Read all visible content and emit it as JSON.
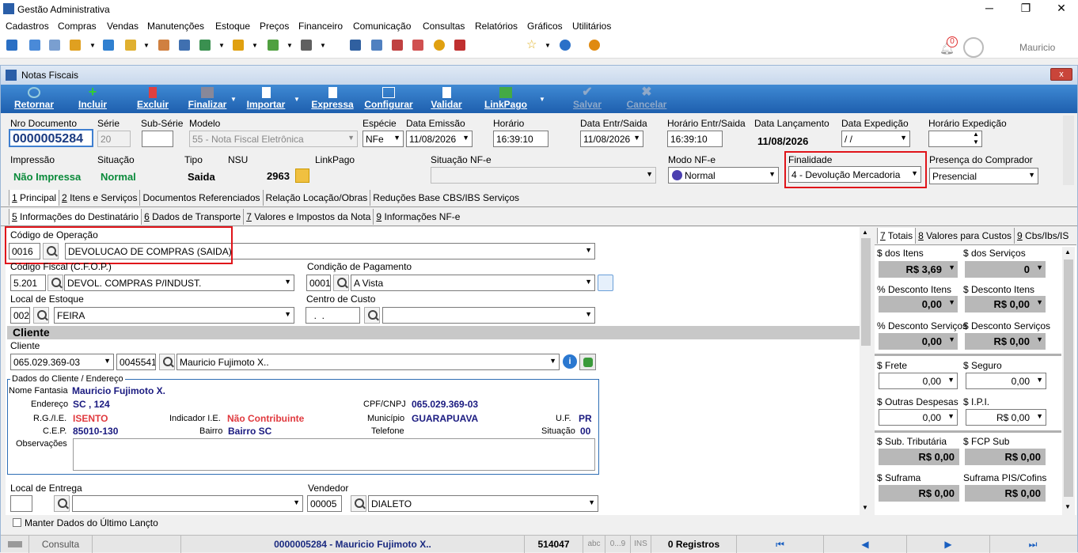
{
  "app": {
    "title": "Gestão Administrativa",
    "user": "Mauricio",
    "notif_count": "0"
  },
  "menu": [
    "Cadastros",
    "Compras",
    "Vendas",
    "Manutenções",
    "Estoque",
    "Preços",
    "Financeiro",
    "Comunicação",
    "Consultas",
    "Relatórios",
    "Gráficos",
    "Utilitários"
  ],
  "window": {
    "title": "Notas Fiscais",
    "close": "x"
  },
  "toolbar": {
    "retornar": "Retornar",
    "incluir": "Incluir",
    "excluir": "Excluir",
    "finalizar": "Finalizar",
    "importar": "Importar",
    "expressa": "Expressa",
    "configurar": "Configurar",
    "validar": "Validar",
    "linkpago": "LinkPago",
    "salvar": "Salvar",
    "cancelar": "Cancelar"
  },
  "header": {
    "nro_label": "Nro Documento",
    "nro": "0000005284",
    "serie_label": "Série",
    "serie": "20",
    "subserie_label": "Sub-Série",
    "subserie": "",
    "modelo_label": "Modelo",
    "modelo": "55 - Nota Fiscal Eletrônica",
    "especie_label": "Espécie",
    "especie": "NFe",
    "emissao_label": "Data Emissão",
    "emissao": "11/08/2026",
    "horario_label": "Horário",
    "horario": "16:39:10",
    "entr_label": "Data Entr/Saida",
    "entr": "11/08/2026",
    "hentr_label": "Horário Entr/Saida",
    "hentr": "16:39:10",
    "lanc_label": "Data Lançamento",
    "lanc": "11/08/2026",
    "exped_label": "Data Expedição",
    "exped": " / /",
    "hexped_label": "Horário Expedição",
    "hexped": "",
    "impressao_label": "Impressão",
    "impressao": "Não Impressa",
    "situacao_label": "Situação",
    "situacao": "Normal",
    "tipo_label": "Tipo",
    "tipo": "Saida",
    "nsu_label": "NSU",
    "nsu": "2963",
    "linkpago_label": "LinkPago",
    "sitnfe_label": "Situação NF-e",
    "sitnfe": "",
    "modonfe_label": "Modo NF-e",
    "modonfe": "Normal",
    "finalidade_label": "Finalidade",
    "finalidade": "4 - Devolução Mercadoria",
    "presenca_label": "Presença do Comprador",
    "presenca": "Presencial"
  },
  "tabs1": [
    {
      "k": "1",
      "t": " Principal"
    },
    {
      "k": "2",
      "t": " Itens e Serviços"
    },
    {
      "k": "",
      "t": "Documentos Referenciados"
    },
    {
      "k": "",
      "t": "Relação Locação/Obras"
    },
    {
      "k": "",
      "t": "Reduções Base CBS/IBS Serviços"
    }
  ],
  "tabs2": [
    {
      "k": "5",
      "t": " Informações do Destinatário"
    },
    {
      "k": "6",
      "t": " Dados de Transporte"
    },
    {
      "k": "7",
      "t": " Valores e Impostos da Nota"
    },
    {
      "k": "9",
      "t": " Informações NF-e"
    }
  ],
  "form": {
    "codop_label": "Código de Operação",
    "codop": "0016",
    "codop_desc": "DEVOLUCAO DE COMPRAS (SAIDA)",
    "cfop_label": "Código Fiscal (C.F.O.P.)",
    "cfop": "5.201",
    "cfop_desc": "DEVOL. COMPRAS P/INDUST.",
    "condpag_label": "Condição de Pagamento",
    "condpag": "0001",
    "condpag_desc": "A Vista",
    "local_label": "Local de Estoque",
    "local": "002",
    "local_desc": "FEIRA",
    "centro_label": "Centro de Custo",
    "centro": "  .  .",
    "centro_desc": "",
    "cliente_section": "Cliente",
    "cliente_label": "Cliente",
    "cpf": "065.029.369-03",
    "cod": "0045541",
    "nome": "Mauricio Fujimoto X..",
    "dados_label": "Dados do Cliente / Endereço",
    "fantasia_label": "Nome Fantasia",
    "fantasia": "Mauricio Fujimoto X.",
    "endereco_label": "Endereço",
    "endereco": "SC , 124",
    "cpfcnpj_label": "CPF/CNPJ",
    "cpfcnpj": "065.029.369-03",
    "rg_label": "R.G./I.E.",
    "rg": "ISENTO",
    "indie_label": "Indicador I.E.",
    "indie": "Não Contribuinte",
    "mun_label": "Município",
    "mun": "GUARAPUAVA",
    "uf_label": "U.F.",
    "uf": "PR",
    "cep_label": "C.E.P.",
    "cep": "85010-130",
    "bairro_label": "Bairro",
    "bairro": "Bairro SC",
    "tel_label": "Telefone",
    "tel": "",
    "sit_label": "Situação",
    "sit": "00",
    "obs_label": "Observações",
    "entrega_label": "Local de Entrega",
    "vendedor_label": "Vendedor",
    "vendedor": "00005",
    "vendedor_desc": "DIALETO",
    "manter": "Manter Dados do Último Lançto"
  },
  "totais": {
    "tabs": [
      {
        "k": "7",
        "t": " Totais"
      },
      {
        "k": "8",
        "t": " Valores para Custos"
      },
      {
        "k": "9",
        "t": " Cbs/Ibs/IS"
      }
    ],
    "itens_label": "$ dos Itens",
    "itens": "R$ 3,69",
    "servicos_label": "$ dos Serviços",
    "servicos": "0",
    "pdesc_itens_label": "% Desconto Itens",
    "pdesc_itens": "0,00",
    "desc_itens_label": "$ Desconto Itens",
    "desc_itens": "R$ 0,00",
    "pdesc_serv_label": "% Desconto Serviços",
    "pdesc_serv": "0,00",
    "desc_serv_label": "$ Desconto Serviços",
    "desc_serv": "R$ 0,00",
    "frete_label": "$ Frete",
    "frete": "0,00",
    "seguro_label": "$ Seguro",
    "seguro": "0,00",
    "outras_label": "$ Outras Despesas",
    "outras": "0,00",
    "ipi_label": "$ I.P.I.",
    "ipi": "R$ 0,00",
    "subtrib_label": "$ Sub. Tributária",
    "subtrib": "R$ 0,00",
    "fcp_label": "$ FCP Sub",
    "fcp": "R$ 0,00",
    "suframa_label": "$ Suframa",
    "suframa": "R$ 0,00",
    "suframapis_label": "Suframa PIS/Cofins",
    "suframapis": "R$ 0,00"
  },
  "status": {
    "mode": "Consulta",
    "doc": "0000005284 - Mauricio Fujimoto X..",
    "num": "514047",
    "abc": "abc",
    "num09": "0...9",
    "ins": "INS",
    "registros": "0 Registros"
  }
}
